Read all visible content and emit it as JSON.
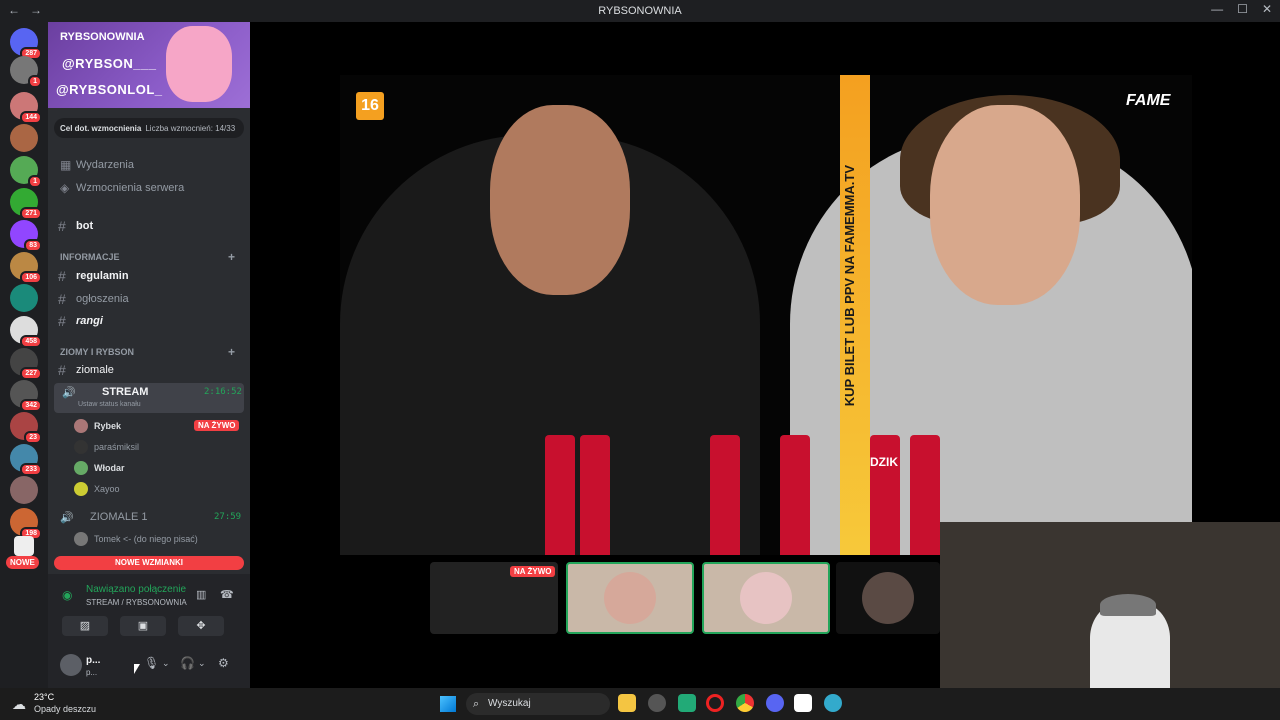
{
  "window": {
    "title": "RYBSONOWNIA",
    "nav_back": "←",
    "nav_fwd": "→",
    "ctrl_min": "—",
    "ctrl_max": "☐",
    "ctrl_close": "✕"
  },
  "rail": {
    "badges": [
      "287",
      "1",
      "144",
      "1",
      "271",
      "83",
      "106",
      "458",
      "227",
      "342",
      "23",
      "233",
      "198"
    ],
    "nowe": "NOWE"
  },
  "server": {
    "name": "RYBSONOWNIA",
    "handle_twitter": "@RYBSON___",
    "handle_youtube": "@RYBSONLOL_",
    "boost_tag": "Cel dot. wzmocnienia",
    "boost_count": "Liczba wzmocnień: 14/33",
    "events": "Wydarzenia",
    "server_boosts": "Wzmocnienia serwera"
  },
  "channels": {
    "bot": "bot",
    "cat_info": "INFORMACJE",
    "regulamin": "regulamin",
    "ogloszenia": "ogłoszenia",
    "rangi": "rangi",
    "cat_ziomy": "ZIOMY I RYBSON",
    "ziomale": "ziomale",
    "stream": "STREAM",
    "stream_time": "2:16:52",
    "stream_status": "Ustaw status kanału",
    "users": [
      "Rybek",
      "paraśmiksil",
      "Włodar",
      "Xayoo"
    ],
    "live_label": "NA ŻYWO",
    "ziomale1": "ZIOMALE 1",
    "ziomale1_time": "27:59",
    "ziomale1_user": "Tomek <- (do niego pisać)",
    "new_mentions": "NOWE WZMIANKI"
  },
  "connection": {
    "status": "Nawiązano połączenie",
    "location": "STREAM / RYBSONOWNIA"
  },
  "userbar": {
    "name": "p...",
    "sub": "p..."
  },
  "stream": {
    "age_rating": "16",
    "brand": "FAME",
    "vertical_text": "KUP BILET LUB PPV NA FAMEMMA.TV",
    "can_text": "DZIK",
    "thumb_live": "NA ŻYWO"
  },
  "taskbar": {
    "temp": "23°C",
    "weather": "Opady deszczu",
    "search_placeholder": "Wyszukaj"
  }
}
